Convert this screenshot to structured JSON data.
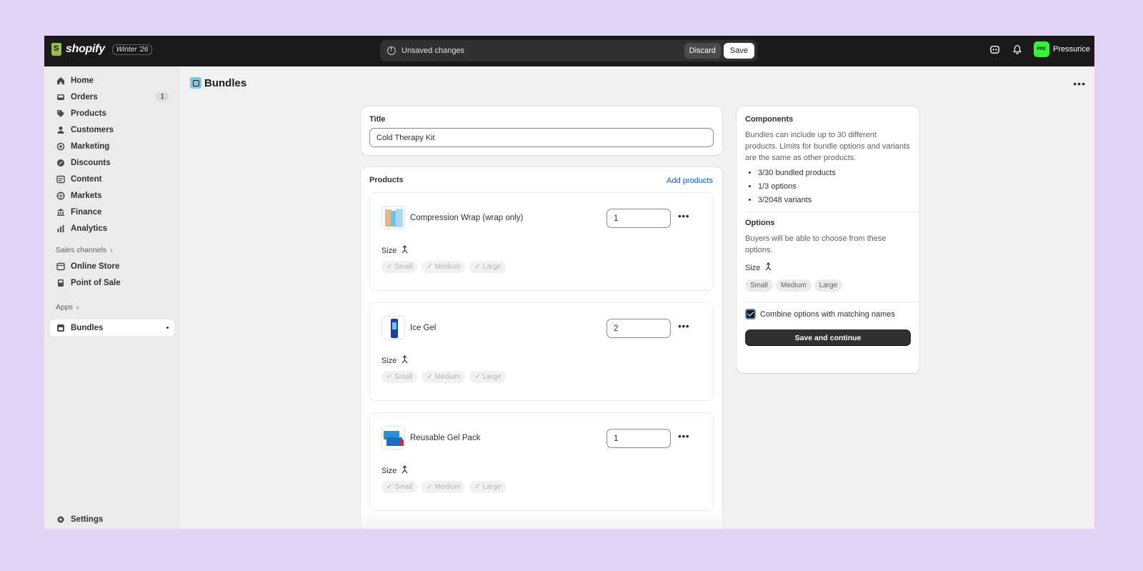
{
  "topbar": {
    "brand": "shopify",
    "edition": "Winter '26",
    "unsaved_label": "Unsaved changes",
    "discard_label": "Discard",
    "save_label": "Save",
    "store_name": "Pressurice",
    "avatar_initials": "PRE"
  },
  "sidebar": {
    "items": [
      {
        "label": "Home",
        "icon": "home-icon"
      },
      {
        "label": "Orders",
        "icon": "inbox-icon",
        "badge": "1"
      },
      {
        "label": "Products",
        "icon": "tag-icon"
      },
      {
        "label": "Customers",
        "icon": "person-icon"
      },
      {
        "label": "Marketing",
        "icon": "target-icon"
      },
      {
        "label": "Discounts",
        "icon": "discount-icon"
      },
      {
        "label": "Content",
        "icon": "content-icon"
      },
      {
        "label": "Markets",
        "icon": "globe-icon"
      },
      {
        "label": "Finance",
        "icon": "bank-icon"
      },
      {
        "label": "Analytics",
        "icon": "chart-icon"
      }
    ],
    "sales_channels_label": "Sales channels",
    "channels": [
      {
        "label": "Online Store",
        "icon": "store-icon"
      },
      {
        "label": "Point of Sale",
        "icon": "pos-icon"
      }
    ],
    "apps_label": "Apps",
    "apps": [
      {
        "label": "Bundles",
        "icon": "bundles-icon"
      }
    ],
    "settings_label": "Settings"
  },
  "header": {
    "title": "Bundles"
  },
  "title_card": {
    "label": "Title",
    "value": "Cold Therapy Kit"
  },
  "products_card": {
    "label": "Products",
    "add_label": "Add products",
    "products": [
      {
        "name": "Compression Wrap (wrap only)",
        "qty": "1",
        "option_label": "Size",
        "values": [
          "Small",
          "Medium",
          "Large"
        ]
      },
      {
        "name": "Ice Gel",
        "qty": "2",
        "option_label": "Size",
        "values": [
          "Small",
          "Medium",
          "Large"
        ]
      },
      {
        "name": "Reusable Gel Pack",
        "qty": "1",
        "option_label": "Size",
        "values": [
          "Small",
          "Medium",
          "Large"
        ]
      }
    ]
  },
  "components": {
    "title": "Components",
    "description": "Bundles can include up to 30 different products. Limits for bundle options and variants are the same as other products.",
    "stats": [
      "3/30 bundled products",
      "1/3 options",
      "3/2048 variants"
    ],
    "options_title": "Options",
    "options_description": "Buyers will be able to choose from these options.",
    "option_label": "Size",
    "option_values": [
      "Small",
      "Medium",
      "Large"
    ],
    "combine_label": "Combine options with matching names",
    "combine_checked": true,
    "save_continue_label": "Save and continue"
  },
  "colors": {
    "topbar": "#1a1a1a",
    "background": "#e3d3f7",
    "link": "#005bd3",
    "avatar": "#36f23b"
  }
}
